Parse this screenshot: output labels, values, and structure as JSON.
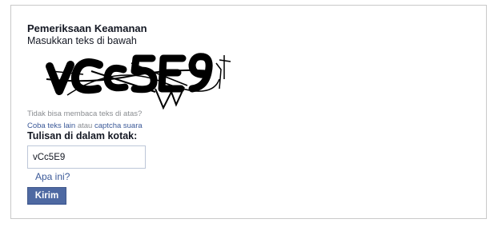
{
  "security_check": {
    "title": "Pemeriksaan Keamanan",
    "subtitle": "Masukkan teks di bawah",
    "captcha_text": "vCc5E9",
    "cant_read": "Tidak bisa membaca teks di atas?",
    "try_other_link": "Coba teks lain",
    "connector": "atau",
    "audio_link": "captcha suara",
    "field_label": "Tulisan di dalam kotak:",
    "input_value": "vCc5E9",
    "whats_this_link": "Apa ini?",
    "submit_label": "Kirim"
  },
  "colors": {
    "link": "#3b5998",
    "button_bg": "#4e69a2",
    "border": "#c9c9c9"
  }
}
